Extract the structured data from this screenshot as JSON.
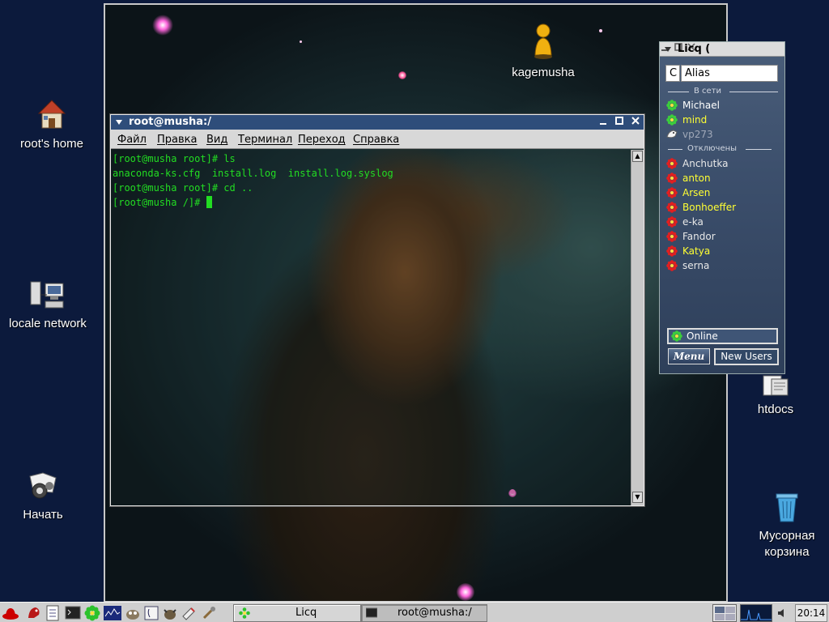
{
  "desktop": {
    "icons": [
      {
        "label": "root's home",
        "icon": "home-icon"
      },
      {
        "label": "locale network",
        "icon": "network-icon"
      },
      {
        "label": "Начать",
        "icon": "start-here-icon"
      },
      {
        "label": "kagemusha",
        "icon": "person-icon"
      },
      {
        "label": "htdocs",
        "icon": "folder-icon"
      },
      {
        "label": "Мусорная\nкорзина",
        "label_line1": "Мусорная",
        "label_line2": "корзина",
        "icon": "trash-icon"
      }
    ]
  },
  "terminal": {
    "title": "root@musha:/",
    "menu": [
      "Файл",
      "Правка",
      "Вид",
      "Терминал",
      "Переход",
      "Справка"
    ],
    "lines": [
      "[root@musha root]# ls",
      "anaconda-ks.cfg  install.log  install.log.syslog",
      "[root@musha root]# cd ..",
      "[root@musha /]# "
    ],
    "text_color": "#22dd22",
    "scroll_up": "▲",
    "scroll_down": "▼"
  },
  "licq": {
    "title": "Licq (",
    "column_c": "C",
    "column_alias": "Alias",
    "group_online": "В сети",
    "group_offline": "Отключены",
    "online_contacts": [
      {
        "name": "Michael",
        "color": "#ffffff",
        "status": "online"
      },
      {
        "name": "mind",
        "color": "#ffff33",
        "status": "online"
      },
      {
        "name": "vp273",
        "color": "#a0a8b8",
        "status": "away"
      }
    ],
    "offline_contacts": [
      {
        "name": "Anchutka",
        "color": "#e8e8e8"
      },
      {
        "name": "anton",
        "color": "#ffff33"
      },
      {
        "name": "Arsen",
        "color": "#ffff33"
      },
      {
        "name": "Bonhoeffer",
        "color": "#ffff33"
      },
      {
        "name": "e-ka",
        "color": "#e8e8e8"
      },
      {
        "name": "Fandor",
        "color": "#e8e8e8"
      },
      {
        "name": "Katya",
        "color": "#ffff33"
      },
      {
        "name": "serna",
        "color": "#e8e8e8"
      }
    ],
    "status": "Online",
    "menu_button": "Menu",
    "new_users_button": "New Users"
  },
  "taskbar": {
    "tasks": [
      {
        "label": "Licq",
        "icon": "licq-flower-icon"
      },
      {
        "label": "root@musha:/",
        "icon": "terminal-icon"
      }
    ],
    "clock": "20:14"
  }
}
